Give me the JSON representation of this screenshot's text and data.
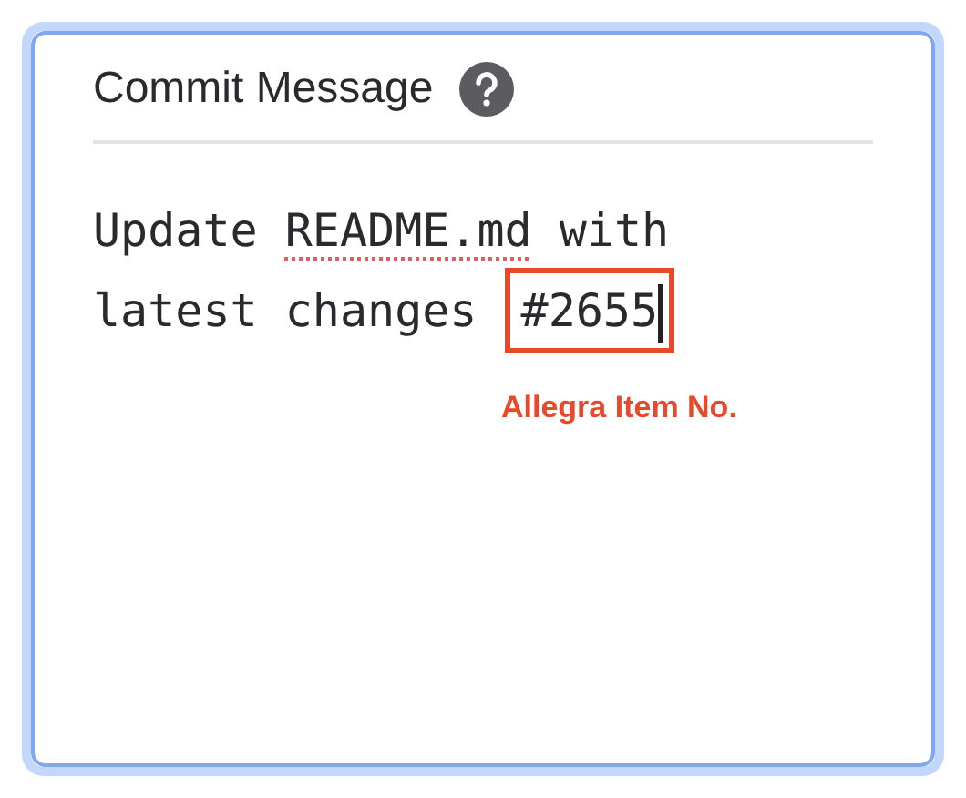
{
  "panel": {
    "title": "Commit Message"
  },
  "message": {
    "segments": [
      {
        "text": "Update ",
        "kind": "plain"
      },
      {
        "text": "README.md",
        "kind": "misspelled"
      },
      {
        "text": " with latest changes ",
        "kind": "plain"
      },
      {
        "text": "#2655",
        "kind": "highlighted"
      }
    ]
  },
  "annotation": {
    "text": "Allegra Item No."
  }
}
